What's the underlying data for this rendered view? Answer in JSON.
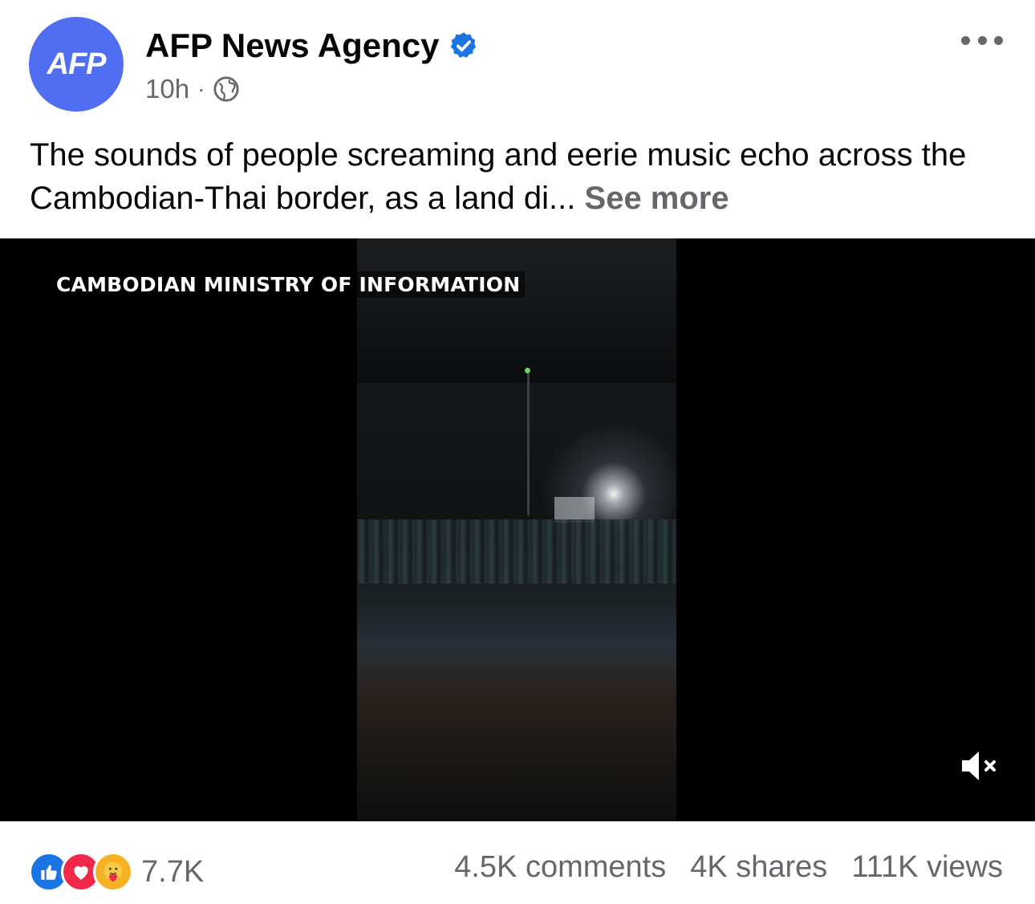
{
  "post": {
    "page_name": "AFP News Agency",
    "avatar_text": "AFP",
    "time": "10h",
    "separator": "·",
    "caption": "The sounds of people screaming and eerie music echo across the Cambodian-Thai border, as a land di...",
    "see_more": "See more"
  },
  "video": {
    "watermark": "CAMBODIAN MINISTRY OF INFORMATION",
    "muted": true
  },
  "engagement": {
    "reaction_count": "7.7K",
    "comments": "4.5K comments",
    "shares": "4K shares",
    "views": "111K views"
  },
  "icons": {
    "verified": "verified-badge-icon",
    "globe": "globe-icon",
    "more": "more-options-icon",
    "mute": "speaker-muted-icon",
    "reactions": [
      "like-icon",
      "love-icon",
      "care-icon"
    ]
  },
  "colors": {
    "brand": "#4f6ef2",
    "verified": "#1b74e4",
    "secondary_text": "#65676b",
    "like": "#1b74e4",
    "love": "#f0284a",
    "care": "#f7b125"
  }
}
